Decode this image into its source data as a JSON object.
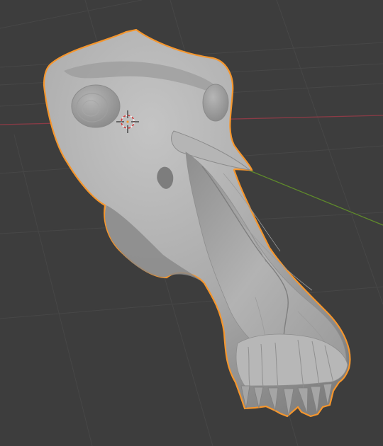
{
  "viewport": {
    "background_color": "#3d3d3d",
    "grid_line_color": "#474747",
    "x_axis_color": "#8b3b46",
    "y_axis_color": "#5f8a2b",
    "show_grid": true
  },
  "object": {
    "name": "",
    "selected": true,
    "outline_color": "#f5962d",
    "mesh_color": "#a8a8a8"
  },
  "cursor_3d": {
    "icon": "crosshair-icon"
  }
}
